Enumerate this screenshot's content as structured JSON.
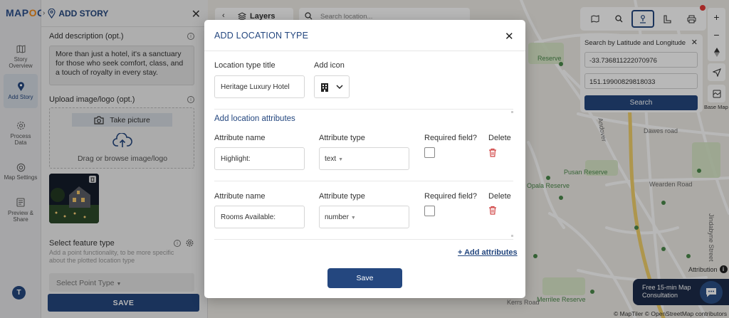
{
  "brand": {
    "logo_left": "MAP",
    "logo_o": "O",
    "logo_right": "G"
  },
  "rail": {
    "items": [
      {
        "label": "Story Overview",
        "icon": "map-icon"
      },
      {
        "label": "Add Story",
        "icon": "pin-icon",
        "active": true
      },
      {
        "label": "Process Data",
        "icon": "gear-icon"
      },
      {
        "label": "Map Settings",
        "icon": "settings-icon"
      },
      {
        "label": "Preview & Share",
        "icon": "preview-icon"
      }
    ],
    "avatar_initial": "T"
  },
  "panel": {
    "title": "ADD STORY",
    "desc_label": "Add description (opt.)",
    "desc_text": "More than just a hotel, it's a sanctuary for those who seek comfort, class, and a touch of royalty in every stay.",
    "upload_label": "Upload image/logo (opt.)",
    "take_picture": "Take picture",
    "drag_text": "Drag or browse image/logo",
    "feature_label": "Select feature type",
    "feature_sub": "Add a point functionality, to be more specific about the plotted location type",
    "point_select": "Select Point Type",
    "save": "SAVE"
  },
  "map": {
    "layers": "Layers",
    "search_placeholder": "Search location...",
    "labels": [
      {
        "text": "Dawes road",
        "green": false
      },
      {
        "text": "Pusan Reserve",
        "green": true
      },
      {
        "text": "Opala Reserve",
        "green": true
      },
      {
        "text": "Wearden Road",
        "green": false
      },
      {
        "text": "Merrilee Reserve",
        "green": true
      },
      {
        "text": "Kerrs Road",
        "green": false
      },
      {
        "text": "Jindabyne Street",
        "green": false
      },
      {
        "text": "Andover",
        "green": false
      },
      {
        "text": "Reserve",
        "green": true
      }
    ],
    "latlng": {
      "title": "Search by Latitude and Longitude",
      "lat": "-33.736811222070976",
      "lng": "151.19900829818033",
      "search": "Search"
    },
    "basemap": "Base Map",
    "attribution": "Attribution",
    "consult_line1": "Free 15-min Map",
    "consult_line2": "Consultation",
    "copyright": "© MapTiler © OpenStreetMap contributors"
  },
  "modal": {
    "title": "ADD LOCATION TYPE",
    "type_title_label": "Location type title",
    "type_title_value": "Heritage Luxury Hotel",
    "icon_label": "Add icon",
    "attrs_title": "Add location attributes",
    "col_name": "Attribute name",
    "col_type": "Attribute type",
    "col_required": "Required field?",
    "col_delete": "Delete",
    "rows": [
      {
        "name": "Highlight:",
        "type": "text"
      },
      {
        "name": "Rooms Available:",
        "type": "number"
      }
    ],
    "add_attributes": "+ Add attributes",
    "save": "Save"
  }
}
